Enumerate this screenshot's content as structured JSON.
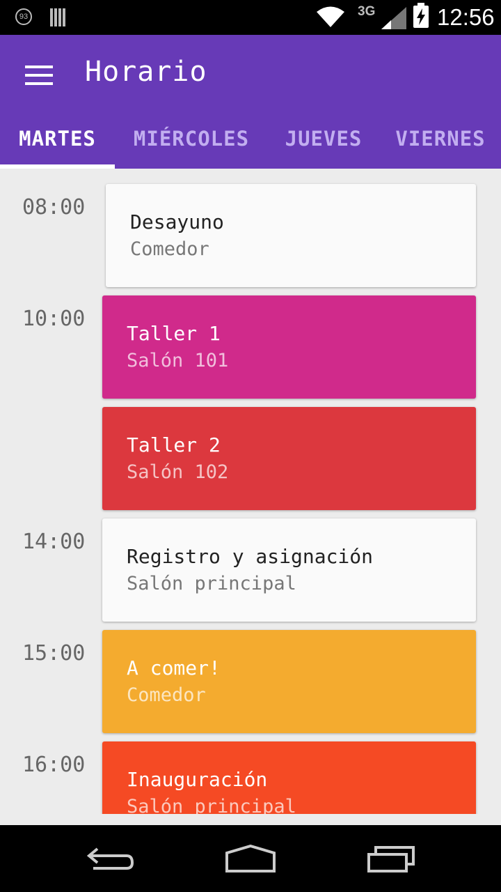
{
  "status_bar": {
    "notification_count": "93",
    "network": "3G",
    "time": "12:56"
  },
  "app_bar": {
    "title": "Horario"
  },
  "tabs": [
    {
      "label": "MARTES",
      "active": true
    },
    {
      "label": "MIÉRCOLES",
      "active": false
    },
    {
      "label": "JUEVES",
      "active": false
    },
    {
      "label": "VIERNES",
      "active": false
    }
  ],
  "schedule": [
    {
      "time": "08:00",
      "title": "Desayuno",
      "location": "Comedor",
      "color": "#fafafa"
    },
    {
      "time": "10:00",
      "title": "Taller 1",
      "location": "Salón 101",
      "color": "#d02a8b"
    },
    {
      "time": "",
      "title": "Taller 2",
      "location": "Salón 102",
      "color": "#dc383e"
    },
    {
      "time": "14:00",
      "title": "Registro y asignación",
      "location": "Salón principal",
      "color": "#fafafa"
    },
    {
      "time": "15:00",
      "title": "A comer!",
      "location": "Comedor",
      "color": "#f4ab2f"
    },
    {
      "time": "16:00",
      "title": "Inauguración",
      "location": "Salón principal",
      "color": "#f54a24"
    }
  ],
  "colors": {
    "primary": "#673ab7",
    "tab_inactive": "#c2aef0"
  }
}
